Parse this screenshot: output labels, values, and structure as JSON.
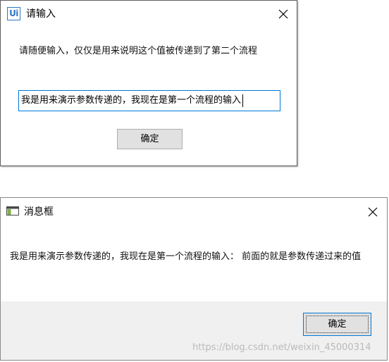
{
  "input_dialog": {
    "title": "请输入",
    "logo_text": "Ui",
    "prompt": "请随便输入，仅仅是用来说明这个值被传递到了第二个流程",
    "input_value": "我是用来演示参数传递的，我现在是第一个流程的输入",
    "ok_label": "确定"
  },
  "message_box": {
    "title": "消息框",
    "message": "我是用来演示参数传递的，我现在是第一个流程的输入： 前面的就是参数传递过来的值",
    "ok_label": "确定"
  },
  "watermark": {
    "text": "https://blog.csdn.net/weixin_45000314"
  },
  "colors": {
    "accent": "#0078d7",
    "logo_blue": "#2d76c8",
    "button_face": "#e1e1e1",
    "footer_bg": "#f0f0f0"
  },
  "icons": {
    "input_title_icon": "uipath-logo-icon",
    "msg_title_icon": "window-icon",
    "close": "close-icon"
  }
}
